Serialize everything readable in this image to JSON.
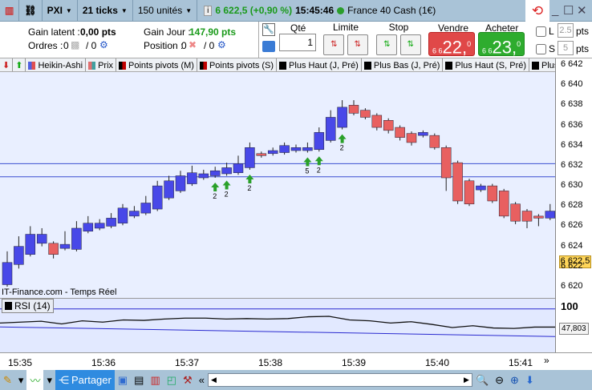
{
  "toolbar": {
    "symbol": "PXI",
    "ticks": "21 ticks",
    "units": "150 unités",
    "quote": "6 622,5 (+0,90 %)",
    "time": "15:45:46",
    "instrument": "France 40 Cash (1€)"
  },
  "order": {
    "gain_latent_label": "Gain latent :",
    "gain_latent": "0,00 pts",
    "gain_jour_label": "Gain Jour :",
    "gain_jour": "147,90 pts",
    "ordres_label": "Ordres :",
    "ordres_count": "0",
    "ordres_sep": "/ 0",
    "position_label": "Position :",
    "position_count": "0",
    "position_sep": "/ 0",
    "qte_label": "Qté",
    "qte_value": "1",
    "limite_label": "Limite",
    "stop_label": "Stop",
    "vendre_label": "Vendre",
    "vendre_prefix": "6 6",
    "vendre_big": "22,",
    "vendre_sup": "0",
    "acheter_label": "Acheter",
    "acheter_prefix": "6 6",
    "acheter_big": "23,",
    "acheter_sup": "0",
    "l_label": "L",
    "l_value": "2.5",
    "s_label": "S",
    "s_value": "5",
    "pts": "pts"
  },
  "indicators": [
    {
      "label": "Heikin-Ashi",
      "c1": "#5060e0",
      "c2": "#e05050"
    },
    {
      "label": "Prix",
      "c1": "#e07070",
      "c2": "#40a0a0"
    },
    {
      "label": "Points pivots (M)",
      "c1": "#000",
      "c2": "#c00000"
    },
    {
      "label": "Points pivots (S)",
      "c1": "#000",
      "c2": "#c00000"
    },
    {
      "label": "Plus Haut (J, Pré)",
      "c1": "#000",
      "c2": "#000"
    },
    {
      "label": "Plus Bas (J, Pré)",
      "c1": "#000",
      "c2": "#000"
    },
    {
      "label": "Plus Haut (S, Pré)",
      "c1": "#000",
      "c2": "#000"
    },
    {
      "label": "Plus",
      "c1": "#000",
      "c2": "#000"
    }
  ],
  "chart_data": {
    "type": "candlestick",
    "ylim": [
      6619,
      6643
    ],
    "y_ticks": [
      "6 642",
      "6 640",
      "6 638",
      "6 636",
      "6 634",
      "6 632",
      "6 630",
      "6 628",
      "6 626",
      "6 624",
      "6 622",
      "6 620"
    ],
    "y_tick_values": [
      6642,
      6640,
      6638,
      6636,
      6634,
      6632,
      6630,
      6628,
      6626,
      6624,
      6622,
      6620
    ],
    "last_price": 6622.5,
    "last_price_label": "6 622,5",
    "levels": [
      6632.2,
      6630.9
    ],
    "candles": [
      [
        6620.2,
        6622.4,
        6623.5,
        6620
      ],
      [
        6622.2,
        6624,
        6625,
        6621.8
      ],
      [
        6623.2,
        6625.2,
        6626,
        6623
      ],
      [
        6624.3,
        6625.2,
        6625.8,
        6624
      ],
      [
        6624.3,
        6623.2,
        6624.5,
        6622.8
      ],
      [
        6623.8,
        6624.2,
        6625.5,
        6623.6
      ],
      [
        6623.7,
        6625.8,
        6626.5,
        6623.5
      ],
      [
        6625.5,
        6626.3,
        6627,
        6625.3
      ],
      [
        6625.8,
        6626.3,
        6626.7,
        6625.6
      ],
      [
        6626,
        6626.8,
        6627.3,
        6625.8
      ],
      [
        6626.3,
        6627.8,
        6628.2,
        6626.1
      ],
      [
        6627,
        6627.5,
        6628,
        6626.8
      ],
      [
        6627.3,
        6628.3,
        6629,
        6627.1
      ],
      [
        6627.7,
        6630,
        6630.5,
        6627.5
      ],
      [
        6628.8,
        6630.5,
        6631,
        6628.6
      ],
      [
        6629.5,
        6631,
        6631.5,
        6629.3
      ],
      [
        6630.2,
        6631.3,
        6632,
        6630
      ],
      [
        6630.8,
        6631.2,
        6631.6,
        6630.6
      ],
      [
        6631,
        6631.5,
        6631.9,
        6630.8
      ],
      [
        6631.2,
        6631.8,
        6632.3,
        6631
      ],
      [
        6631.3,
        6632.2,
        6633,
        6631.1
      ],
      [
        6631.8,
        6633.8,
        6634.3,
        6631.6
      ],
      [
        6633.2,
        6633,
        6633.4,
        6632.8
      ],
      [
        6633.2,
        6633.5,
        6633.8,
        6633
      ],
      [
        6633.3,
        6634,
        6634.3,
        6633.1
      ],
      [
        6633.5,
        6633.8,
        6634.1,
        6633.3
      ],
      [
        6633.5,
        6633.8,
        6634.3,
        6633.3
      ],
      [
        6633.6,
        6635.3,
        6635.8,
        6633.4
      ],
      [
        6634.5,
        6636.8,
        6637.5,
        6634.3
      ],
      [
        6635.8,
        6637.8,
        6638.5,
        6635.6
      ],
      [
        6638,
        6637.2,
        6638.5,
        6637
      ],
      [
        6637.5,
        6636.8,
        6637.7,
        6636.6
      ],
      [
        6637,
        6635.8,
        6637.2,
        6635.5
      ],
      [
        6636.5,
        6635.5,
        6636.7,
        6635.2
      ],
      [
        6635.8,
        6634.8,
        6636,
        6634.5
      ],
      [
        6635.2,
        6634.3,
        6635.4,
        6634
      ],
      [
        6635,
        6635.3,
        6635.5,
        6634.8
      ],
      [
        6635,
        6633.8,
        6635.2,
        6633.6
      ],
      [
        6633.8,
        6630.8,
        6634,
        6629.5
      ],
      [
        6632.3,
        6628.5,
        6632.5,
        6628.2
      ],
      [
        6630.5,
        6628.2,
        6630.7,
        6628
      ],
      [
        6629.6,
        6630,
        6630.2,
        6629.4
      ],
      [
        6630,
        6628.5,
        6630.2,
        6628.3
      ],
      [
        6629.5,
        6627,
        6629.7,
        6626.8
      ],
      [
        6628.2,
        6626.5,
        6628.4,
        6626.2
      ],
      [
        6627.5,
        6626.5,
        6627.7,
        6625.8
      ],
      [
        6627,
        6626.8,
        6627.2,
        6626
      ],
      [
        6626.8,
        6627.5,
        6628.2,
        6626.6
      ]
    ],
    "signals": [
      {
        "i": 18,
        "label": "2"
      },
      {
        "i": 19,
        "label": "2"
      },
      {
        "i": 21,
        "label": "2"
      },
      {
        "i": 26,
        "label": "5"
      },
      {
        "i": 27,
        "label": "2"
      },
      {
        "i": 29,
        "label": "2"
      }
    ],
    "source": "IT-Finance.com - Temps Réel"
  },
  "rsi": {
    "label": "RSI (14)",
    "top_tick": "100",
    "value": "47,803",
    "values": [
      60,
      62,
      64,
      58,
      65,
      62,
      67,
      66,
      69,
      71,
      71,
      69,
      70,
      69,
      70,
      74,
      75,
      67,
      65,
      60,
      63,
      57,
      50,
      54,
      49,
      48,
      51,
      51
    ]
  },
  "time_ticks": [
    "15:35",
    "15:36",
    "15:37",
    "15:38",
    "15:39",
    "15:40",
    "15:41"
  ],
  "bottom": {
    "share": "Partager"
  }
}
